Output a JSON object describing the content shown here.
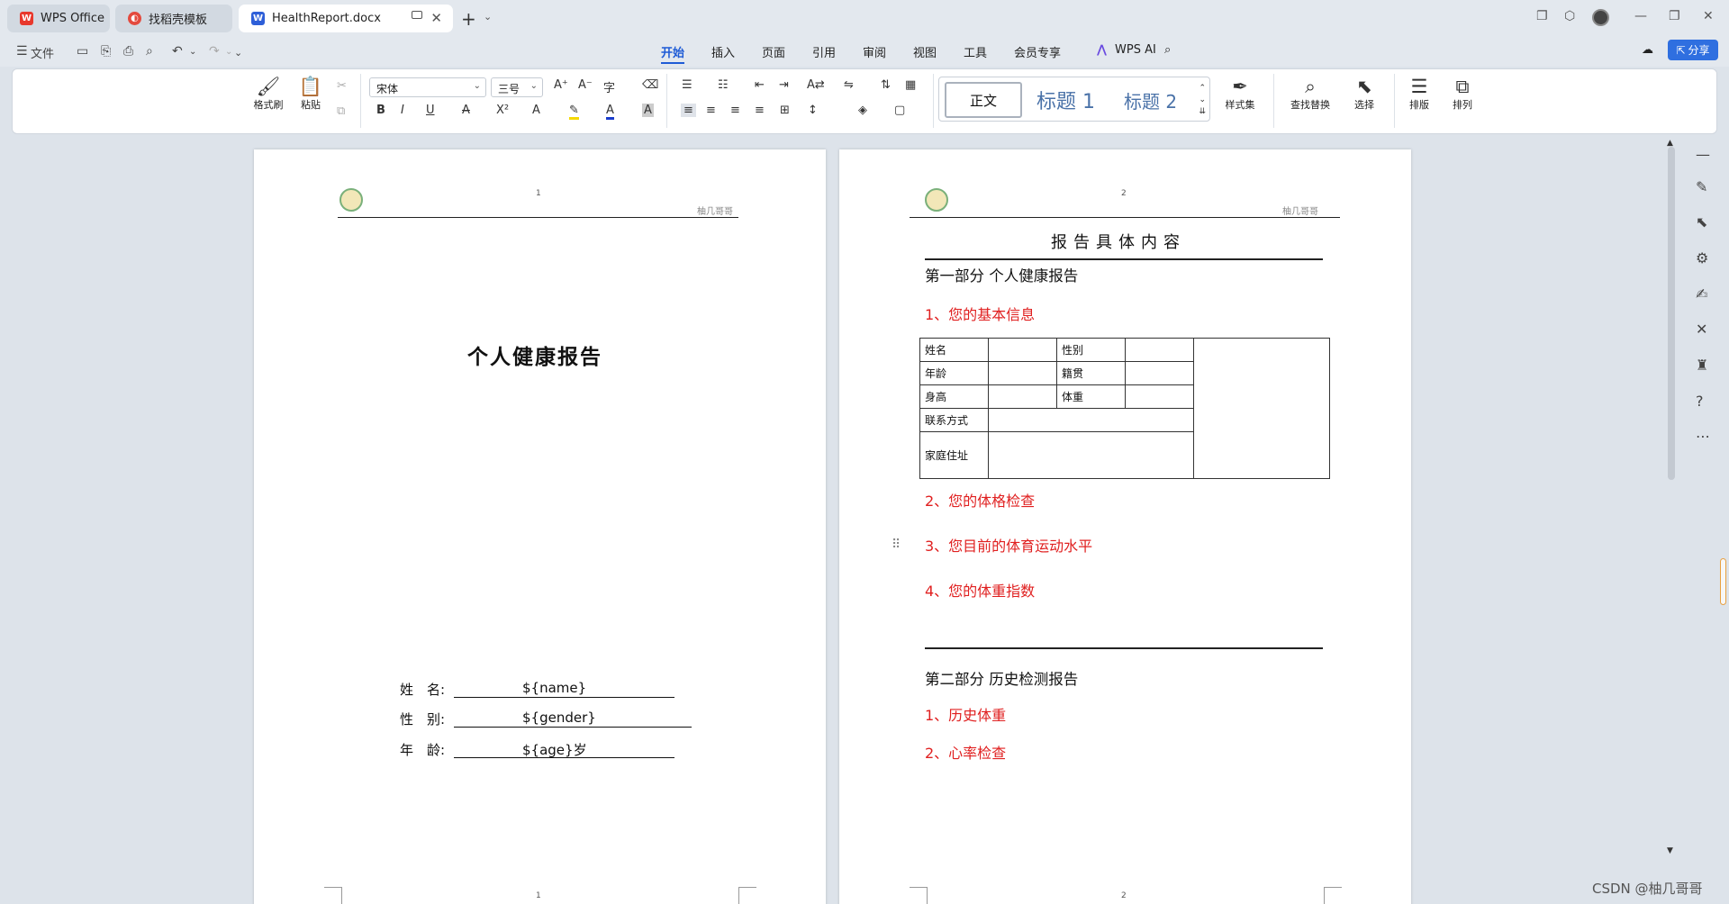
{
  "tabs": [
    {
      "label": "WPS Office",
      "icon": "wps-logo-icon"
    },
    {
      "label": "找稻壳模板",
      "icon": "docer-icon"
    },
    {
      "label": "HealthReport.docx",
      "icon": "word-doc-icon"
    }
  ],
  "toolbar": {
    "file_label": "文件"
  },
  "menu": {
    "items": [
      "开始",
      "插入",
      "页面",
      "引用",
      "审阅",
      "视图",
      "工具",
      "会员专享"
    ],
    "active": "开始",
    "ai_label": "WPS AI"
  },
  "share_label": "分享",
  "ribbon": {
    "format_painter": "格式刷",
    "paste": "粘贴",
    "font_name": "宋体",
    "font_size": "三号",
    "styles": {
      "normal": "正文",
      "h1": "标题 1",
      "h2": "标题 2"
    },
    "style_set": "样式集",
    "find_replace": "查找替换",
    "select": "选择",
    "layout": "排版",
    "arrange": "排列"
  },
  "page1": {
    "header_page_num": "1",
    "header_right": "柚几哥哥",
    "footer_page_num": "1",
    "title": "个人健康报告",
    "fields": [
      {
        "label": "姓　名:",
        "value": "${name}"
      },
      {
        "label": "性　别:",
        "value": "${gender}"
      },
      {
        "label": "年　龄:",
        "value": "${age}岁"
      }
    ]
  },
  "page2": {
    "header_page_num": "2",
    "header_right": "柚几哥哥",
    "footer_page_num": "2",
    "section_title": "报告具体内容",
    "part1": "第一部分  个人健康报告",
    "items1": [
      "1、您的基本信息",
      "2、您的体格检查",
      "3、您目前的体育运动水平",
      "4、您的体重指数"
    ],
    "table": {
      "name": "姓名",
      "gender": "性别",
      "age": "年龄",
      "native": "籍贯",
      "height": "身高",
      "weight": "体重",
      "contact": "联系方式",
      "address": "家庭住址"
    },
    "part2": "第二部分  历史检测报告",
    "items2": [
      "1、历史体重",
      "2、心率检查"
    ]
  },
  "watermark": "CSDN @柚几哥哥",
  "colors": {
    "accent": "#1e5bd6",
    "red_text": "#e02020",
    "share_bg": "#2f6fe0"
  }
}
